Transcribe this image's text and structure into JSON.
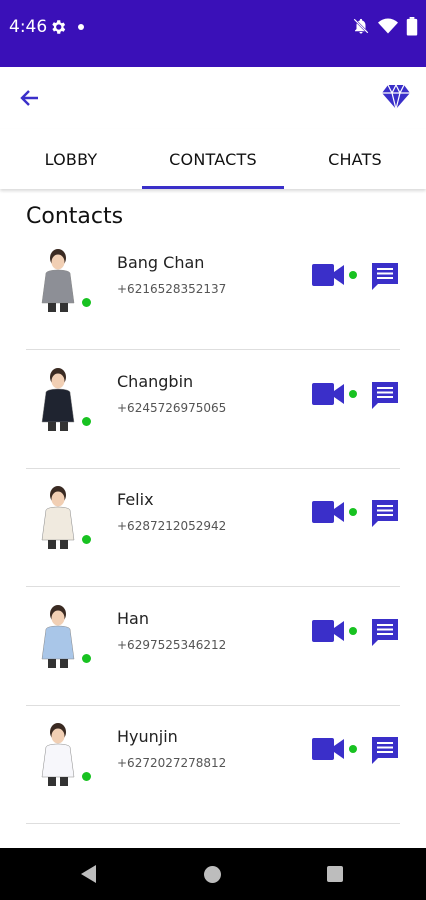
{
  "status_bar": {
    "time": "4:46"
  },
  "toolbar": {
    "back_icon": "arrow-left-icon",
    "premium_icon": "diamond-icon"
  },
  "tabs": [
    {
      "label": "LOBBY",
      "active": false
    },
    {
      "label": "CONTACTS",
      "active": true
    },
    {
      "label": "CHATS",
      "active": false
    }
  ],
  "section": {
    "title": "Contacts"
  },
  "contacts": [
    {
      "name": "Bang Chan",
      "phone": "+6216528352137",
      "online": true,
      "outfit": "#8d8f96"
    },
    {
      "name": "Changbin",
      "phone": "+6245726975065",
      "online": true,
      "outfit": "#1f2430"
    },
    {
      "name": "Felix",
      "phone": "+6287212052942",
      "online": true,
      "outfit": "#f0eadf"
    },
    {
      "name": "Han",
      "phone": "+6297525346212",
      "online": true,
      "outfit": "#a9c6e8"
    },
    {
      "name": "Hyunjin",
      "phone": "+6272027278812",
      "online": true,
      "outfit": "#f7f7fb"
    }
  ],
  "colors": {
    "accent": "#3a2fc9",
    "status_bar": "#3a10b8",
    "online": "#18c221"
  }
}
